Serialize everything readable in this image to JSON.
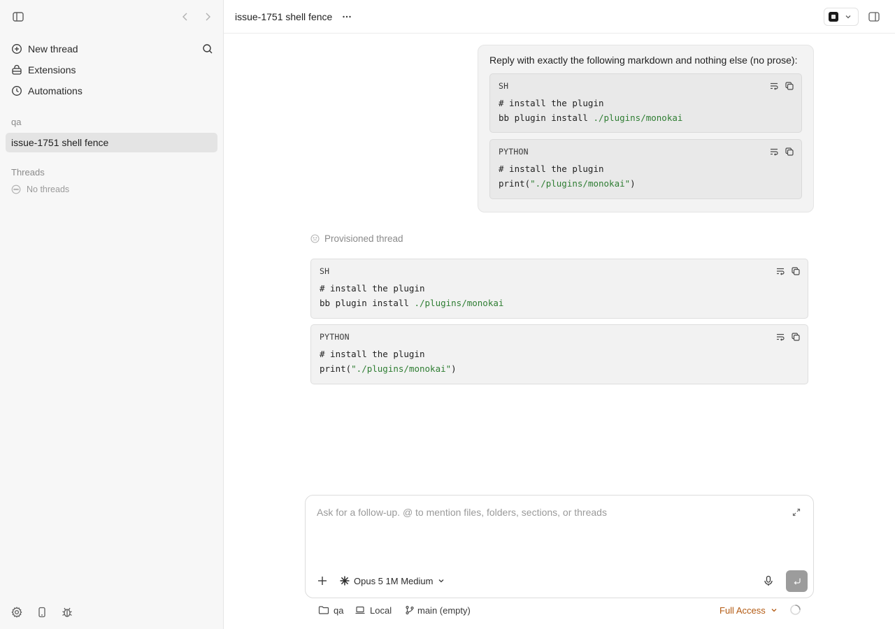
{
  "sidebar": {
    "nav": [
      {
        "label": "New thread",
        "icon": "plus-circle-icon"
      },
      {
        "label": "Extensions",
        "icon": "extensions-icon"
      },
      {
        "label": "Automations",
        "icon": "clock-icon"
      }
    ],
    "project_label": "qa",
    "active_thread": "issue-1751 shell fence",
    "threads_label": "Threads",
    "no_threads": "No threads"
  },
  "header": {
    "title": "issue-1751 shell fence"
  },
  "user_message": {
    "text": "Reply with exactly the following markdown and nothing else (no prose):",
    "blocks": [
      {
        "lang": "SH",
        "comment": "# install the plugin",
        "code_prefix": "bb plugin install ",
        "code_string": "./plugins/monokai",
        "code_suffix": ""
      },
      {
        "lang": "PYTHON",
        "comment": "# install the plugin",
        "code_prefix": "print(",
        "code_string": "\"./plugins/monokai\"",
        "code_suffix": ")"
      }
    ]
  },
  "assistant": {
    "status": "Provisioned thread",
    "blocks": [
      {
        "lang": "SH",
        "comment": "# install the plugin",
        "code_prefix": "bb plugin install ",
        "code_string": "./plugins/monokai",
        "code_suffix": ""
      },
      {
        "lang": "PYTHON",
        "comment": "# install the plugin",
        "code_prefix": "print(",
        "code_string": "\"./plugins/monokai\"",
        "code_suffix": ")"
      }
    ]
  },
  "composer": {
    "placeholder": "Ask for a follow-up. @ to mention files, folders, sections, or threads",
    "model": "Opus 5 1M Medium"
  },
  "footer": {
    "project": "qa",
    "location": "Local",
    "branch": "main (empty)",
    "access": "Full Access"
  },
  "colors": {
    "code_string": "#2e7d32",
    "access": "#b35a12",
    "selected_thread_bg": "#e4e4e4"
  }
}
